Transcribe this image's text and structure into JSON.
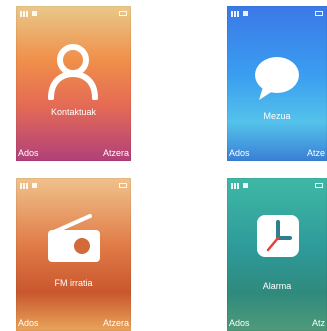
{
  "screens": [
    {
      "label": "Kontaktuak",
      "left_soft": "Ados",
      "right_soft": "Atzera",
      "icon": "person-icon"
    },
    {
      "label": "Mezua",
      "left_soft": "Ados",
      "right_soft": "Atze",
      "icon": "speech-bubble-icon"
    },
    {
      "label": "FM irratia",
      "left_soft": "Ados",
      "right_soft": "Atzera",
      "icon": "radio-icon"
    },
    {
      "label": "Alarma",
      "left_soft": "Ados",
      "right_soft": "Atz",
      "icon": "clock-icon"
    }
  ]
}
